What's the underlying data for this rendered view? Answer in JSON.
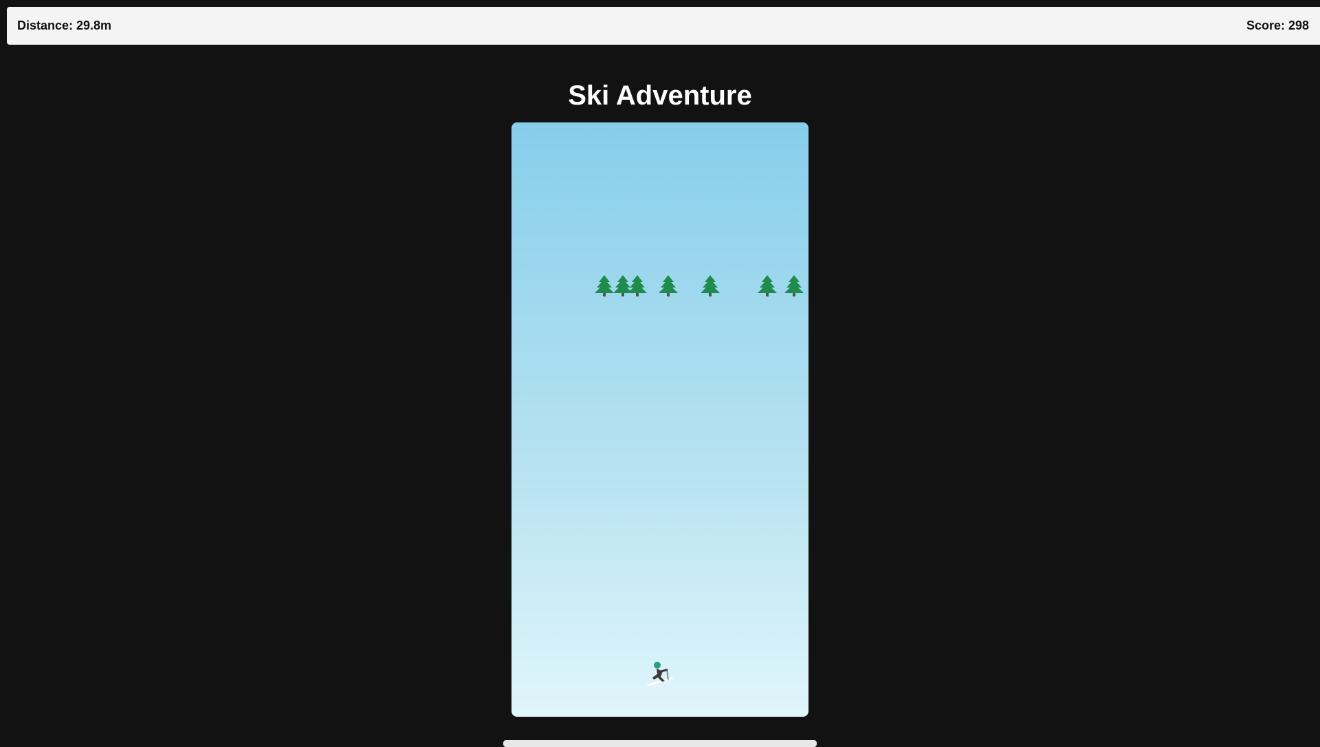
{
  "hud": {
    "distance_label": "Distance: 29.8m",
    "score_label": "Score: 298"
  },
  "game": {
    "title": "Ski Adventure",
    "trees": [
      {
        "name": "tree-icon"
      },
      {
        "name": "tree-icon"
      },
      {
        "name": "tree-icon"
      },
      {
        "name": "tree-icon"
      },
      {
        "name": "tree-icon"
      },
      {
        "name": "tree-icon"
      },
      {
        "name": "tree-icon"
      }
    ],
    "player_icon": "skier-icon",
    "colors": {
      "background": "#121212",
      "hud": "#f4f4f4",
      "sky_top": "#87ceeb",
      "snow_bottom": "#e0f6fb",
      "tree": "#1e8a4a"
    }
  }
}
